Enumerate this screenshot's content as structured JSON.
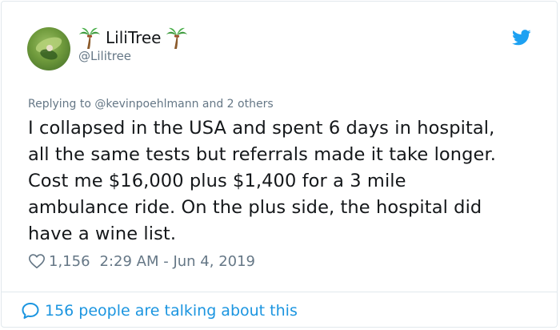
{
  "tweet": {
    "author": {
      "display_name": "LiliTree",
      "handle": "@Lilitree"
    },
    "reply_to": "Replying to @kevinpoehlmann and 2 others",
    "text_lines": [
      "I collapsed in the USA and spent 6 days in hospital,",
      "all the same tests but referrals made it take longer.",
      "Cost me $16,000 plus $1,400 for a 3 mile",
      "ambulance ride. On the plus side, the hospital did",
      "have a wine list."
    ],
    "likes": "1,156",
    "timestamp": "2:29 AM - Jun 4, 2019",
    "conversation_link": "156 people are talking about this"
  },
  "icons": {
    "avatar": "avatar-image",
    "palm_left": "palm-tree-icon",
    "palm_right": "palm-tree-icon",
    "twitter": "twitter-bird-icon",
    "heart": "heart-icon",
    "comment": "speech-bubble-icon"
  },
  "colors": {
    "text": "#14171a",
    "secondary": "#657786",
    "accent": "#1b95e0",
    "border": "#e1e8ed"
  }
}
